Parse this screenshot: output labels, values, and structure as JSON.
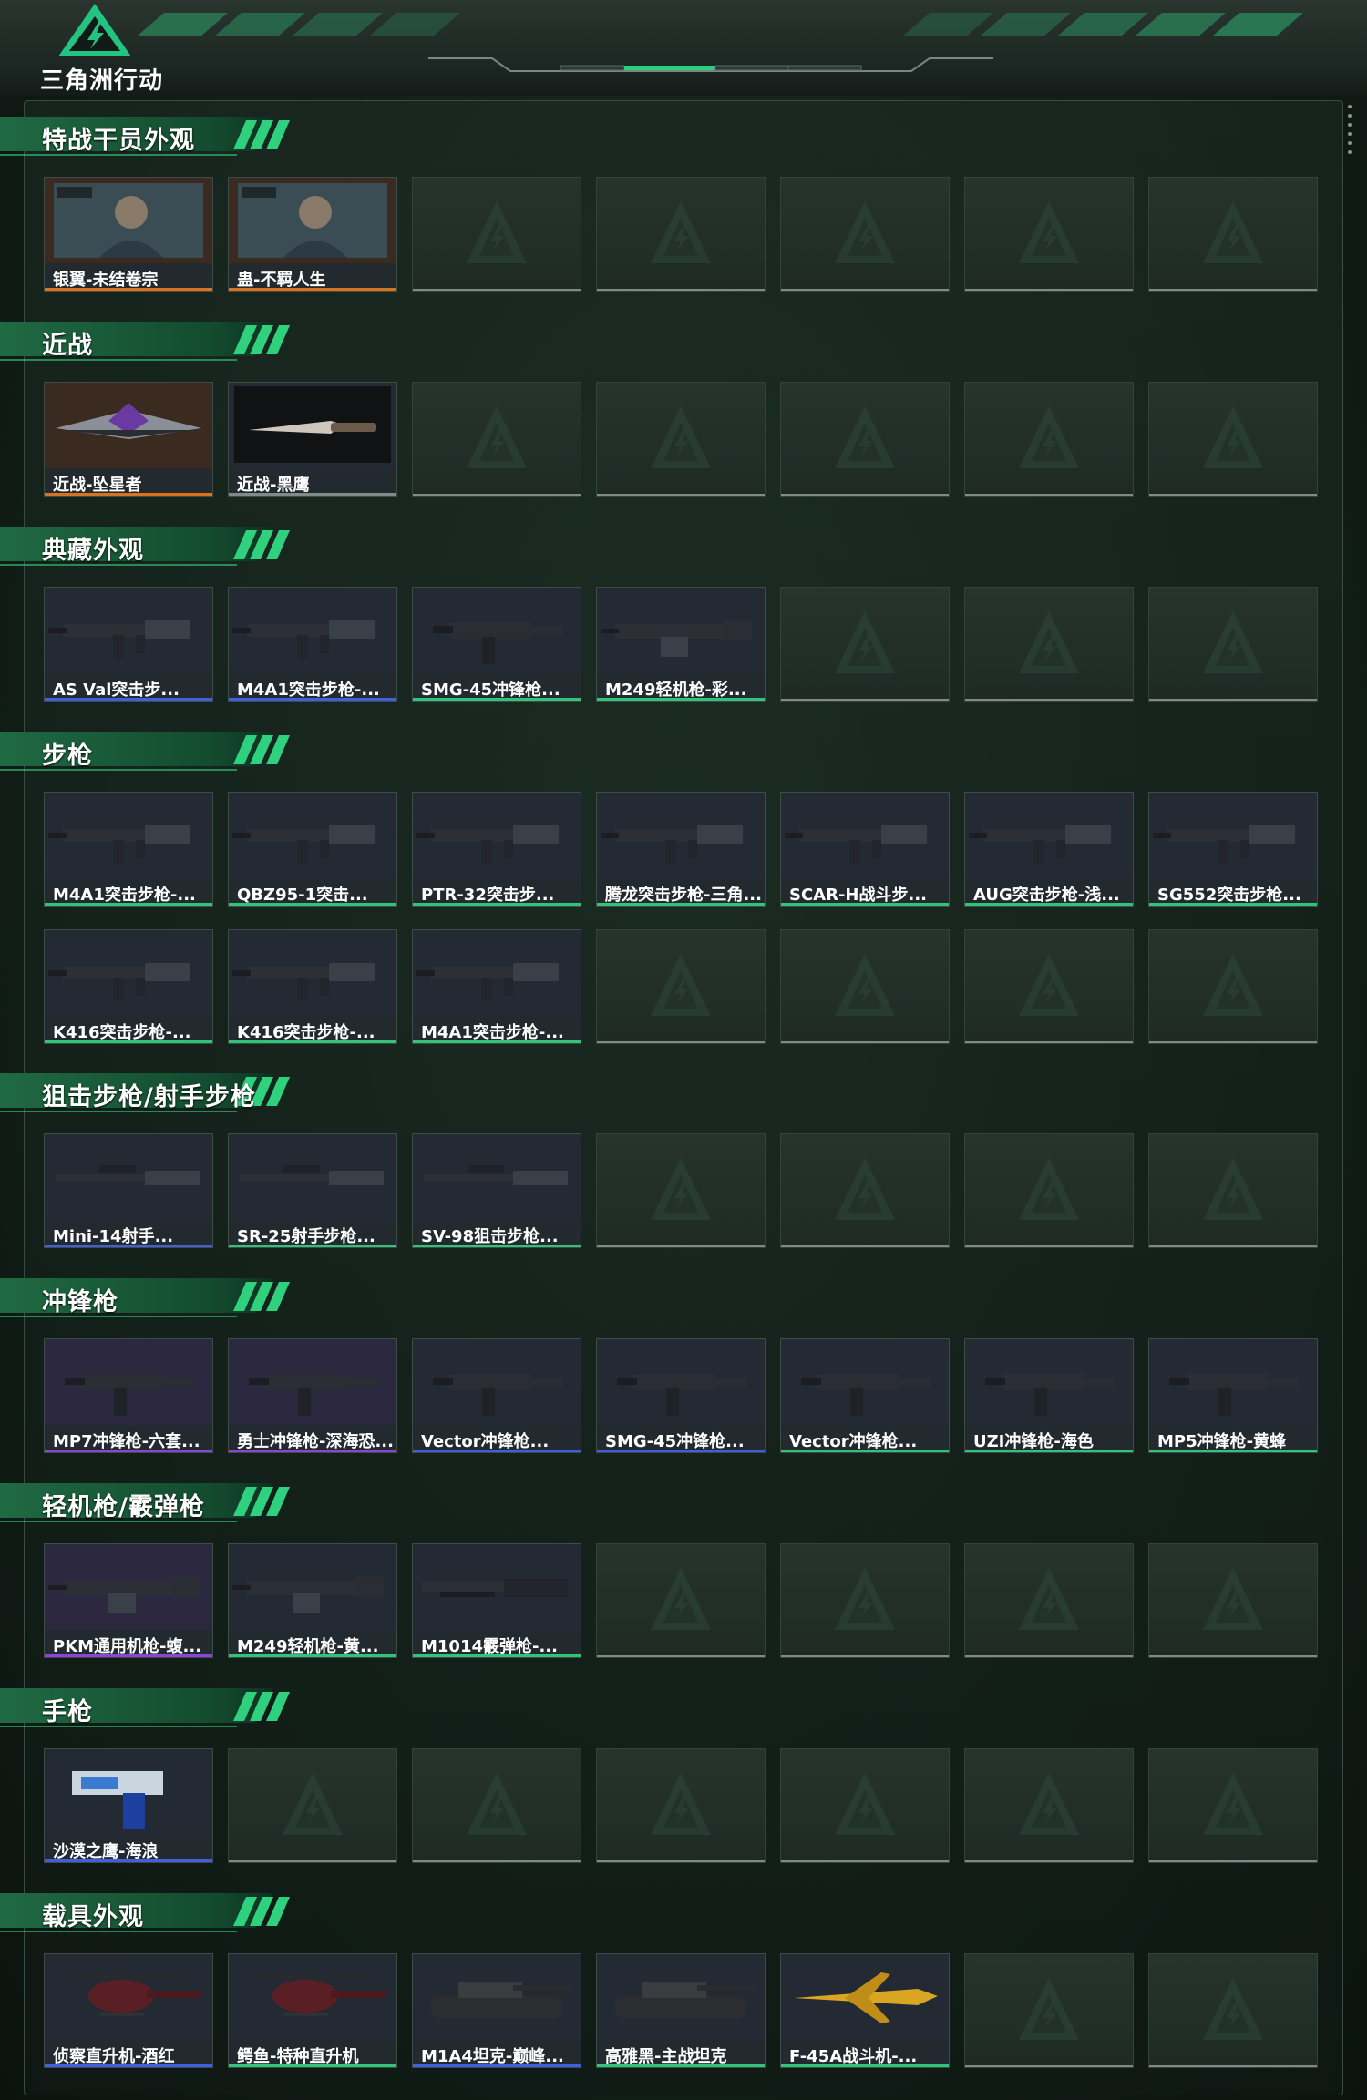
{
  "app": {
    "logo_text": "三角洲行动"
  },
  "colors": {
    "orange": "#d9731f",
    "blue": "#3f5fe0",
    "green": "#2fc47a",
    "purple": "#8c43d8",
    "gray": "#7f8b86"
  },
  "sections": [
    {
      "title": "特战干员外观",
      "items": [
        {
          "label": "银翼-未结卷宗",
          "rarity": "orange",
          "icon": "operator-portrait-icon"
        },
        {
          "label": "蛊-不羁人生",
          "rarity": "orange",
          "icon": "operator-portrait-icon"
        }
      ]
    },
    {
      "title": "近战",
      "items": [
        {
          "label": "近战-坠星者",
          "rarity": "orange",
          "icon": "melee-blade-icon"
        },
        {
          "label": "近战-黑鹰",
          "rarity": "gray",
          "icon": "knife-icon"
        }
      ]
    },
    {
      "title": "典藏外观",
      "items": [
        {
          "label": "AS Val突击步...",
          "rarity": "blue",
          "icon": "rifle-icon"
        },
        {
          "label": "M4A1突击步枪-...",
          "rarity": "blue",
          "icon": "rifle-icon"
        },
        {
          "label": "SMG-45冲锋枪...",
          "rarity": "green",
          "icon": "smg-icon"
        },
        {
          "label": "M249轻机枪-彩...",
          "rarity": "green",
          "icon": "lmg-icon"
        }
      ]
    },
    {
      "title": "步枪",
      "items": [
        {
          "label": "M4A1突击步枪-...",
          "rarity": "green",
          "icon": "rifle-icon"
        },
        {
          "label": "QBZ95-1突击...",
          "rarity": "green",
          "icon": "rifle-icon"
        },
        {
          "label": "PTR-32突击步...",
          "rarity": "green",
          "icon": "rifle-icon"
        },
        {
          "label": "腾龙突击步枪-三角...",
          "rarity": "green",
          "icon": "rifle-icon"
        },
        {
          "label": "SCAR-H战斗步...",
          "rarity": "green",
          "icon": "rifle-icon"
        },
        {
          "label": "AUG突击步枪-浅...",
          "rarity": "green",
          "icon": "rifle-icon"
        },
        {
          "label": "SG552突击步枪...",
          "rarity": "green",
          "icon": "rifle-icon"
        },
        {
          "label": "K416突击步枪-...",
          "rarity": "green",
          "icon": "rifle-icon"
        },
        {
          "label": "K416突击步枪-...",
          "rarity": "green",
          "icon": "rifle-icon"
        },
        {
          "label": "M4A1突击步枪-...",
          "rarity": "green",
          "icon": "rifle-icon"
        }
      ]
    },
    {
      "title": "狙击步枪/射手步枪",
      "items": [
        {
          "label": "Mini-14射手...",
          "rarity": "blue",
          "icon": "sniper-rifle-icon"
        },
        {
          "label": "SR-25射手步枪...",
          "rarity": "green",
          "icon": "sniper-rifle-icon"
        },
        {
          "label": "SV-98狙击步枪...",
          "rarity": "green",
          "icon": "sniper-rifle-icon"
        }
      ]
    },
    {
      "title": "冲锋枪",
      "items": [
        {
          "label": "MP7冲锋枪-六套...",
          "rarity": "purple",
          "icon": "smg-icon"
        },
        {
          "label": "勇士冲锋枪-深海恐...",
          "rarity": "purple",
          "icon": "smg-icon"
        },
        {
          "label": "Vector冲锋枪...",
          "rarity": "blue",
          "icon": "smg-icon"
        },
        {
          "label": "SMG-45冲锋枪...",
          "rarity": "blue",
          "icon": "smg-icon"
        },
        {
          "label": "Vector冲锋枪...",
          "rarity": "green",
          "icon": "smg-icon"
        },
        {
          "label": "UZI冲锋枪-海色",
          "rarity": "green",
          "icon": "smg-icon"
        },
        {
          "label": "MP5冲锋枪-黄蜂",
          "rarity": "green",
          "icon": "smg-icon"
        }
      ]
    },
    {
      "title": "轻机枪/霰弹枪",
      "items": [
        {
          "label": "PKM通用机枪-蝮...",
          "rarity": "purple",
          "icon": "lmg-icon"
        },
        {
          "label": "M249轻机枪-黄...",
          "rarity": "green",
          "icon": "lmg-icon"
        },
        {
          "label": "M1014霰弹枪-...",
          "rarity": "green",
          "icon": "shotgun-icon"
        }
      ]
    },
    {
      "title": "手枪",
      "items": [
        {
          "label": "沙漠之鹰-海浪",
          "rarity": "blue",
          "icon": "pistol-icon"
        }
      ]
    },
    {
      "title": "载具外观",
      "items": [
        {
          "label": "侦察直升机-酒红",
          "rarity": "blue",
          "icon": "helicopter-icon"
        },
        {
          "label": "鳄鱼-特种直升机",
          "rarity": "green",
          "icon": "helicopter-icon"
        },
        {
          "label": "M1A4坦克-巅峰...",
          "rarity": "blue",
          "icon": "tank-icon"
        },
        {
          "label": "高雅黑-主战坦克",
          "rarity": "green",
          "icon": "tank-icon"
        },
        {
          "label": "F-45A战斗机-...",
          "rarity": "green",
          "icon": "jet-icon"
        }
      ]
    }
  ]
}
